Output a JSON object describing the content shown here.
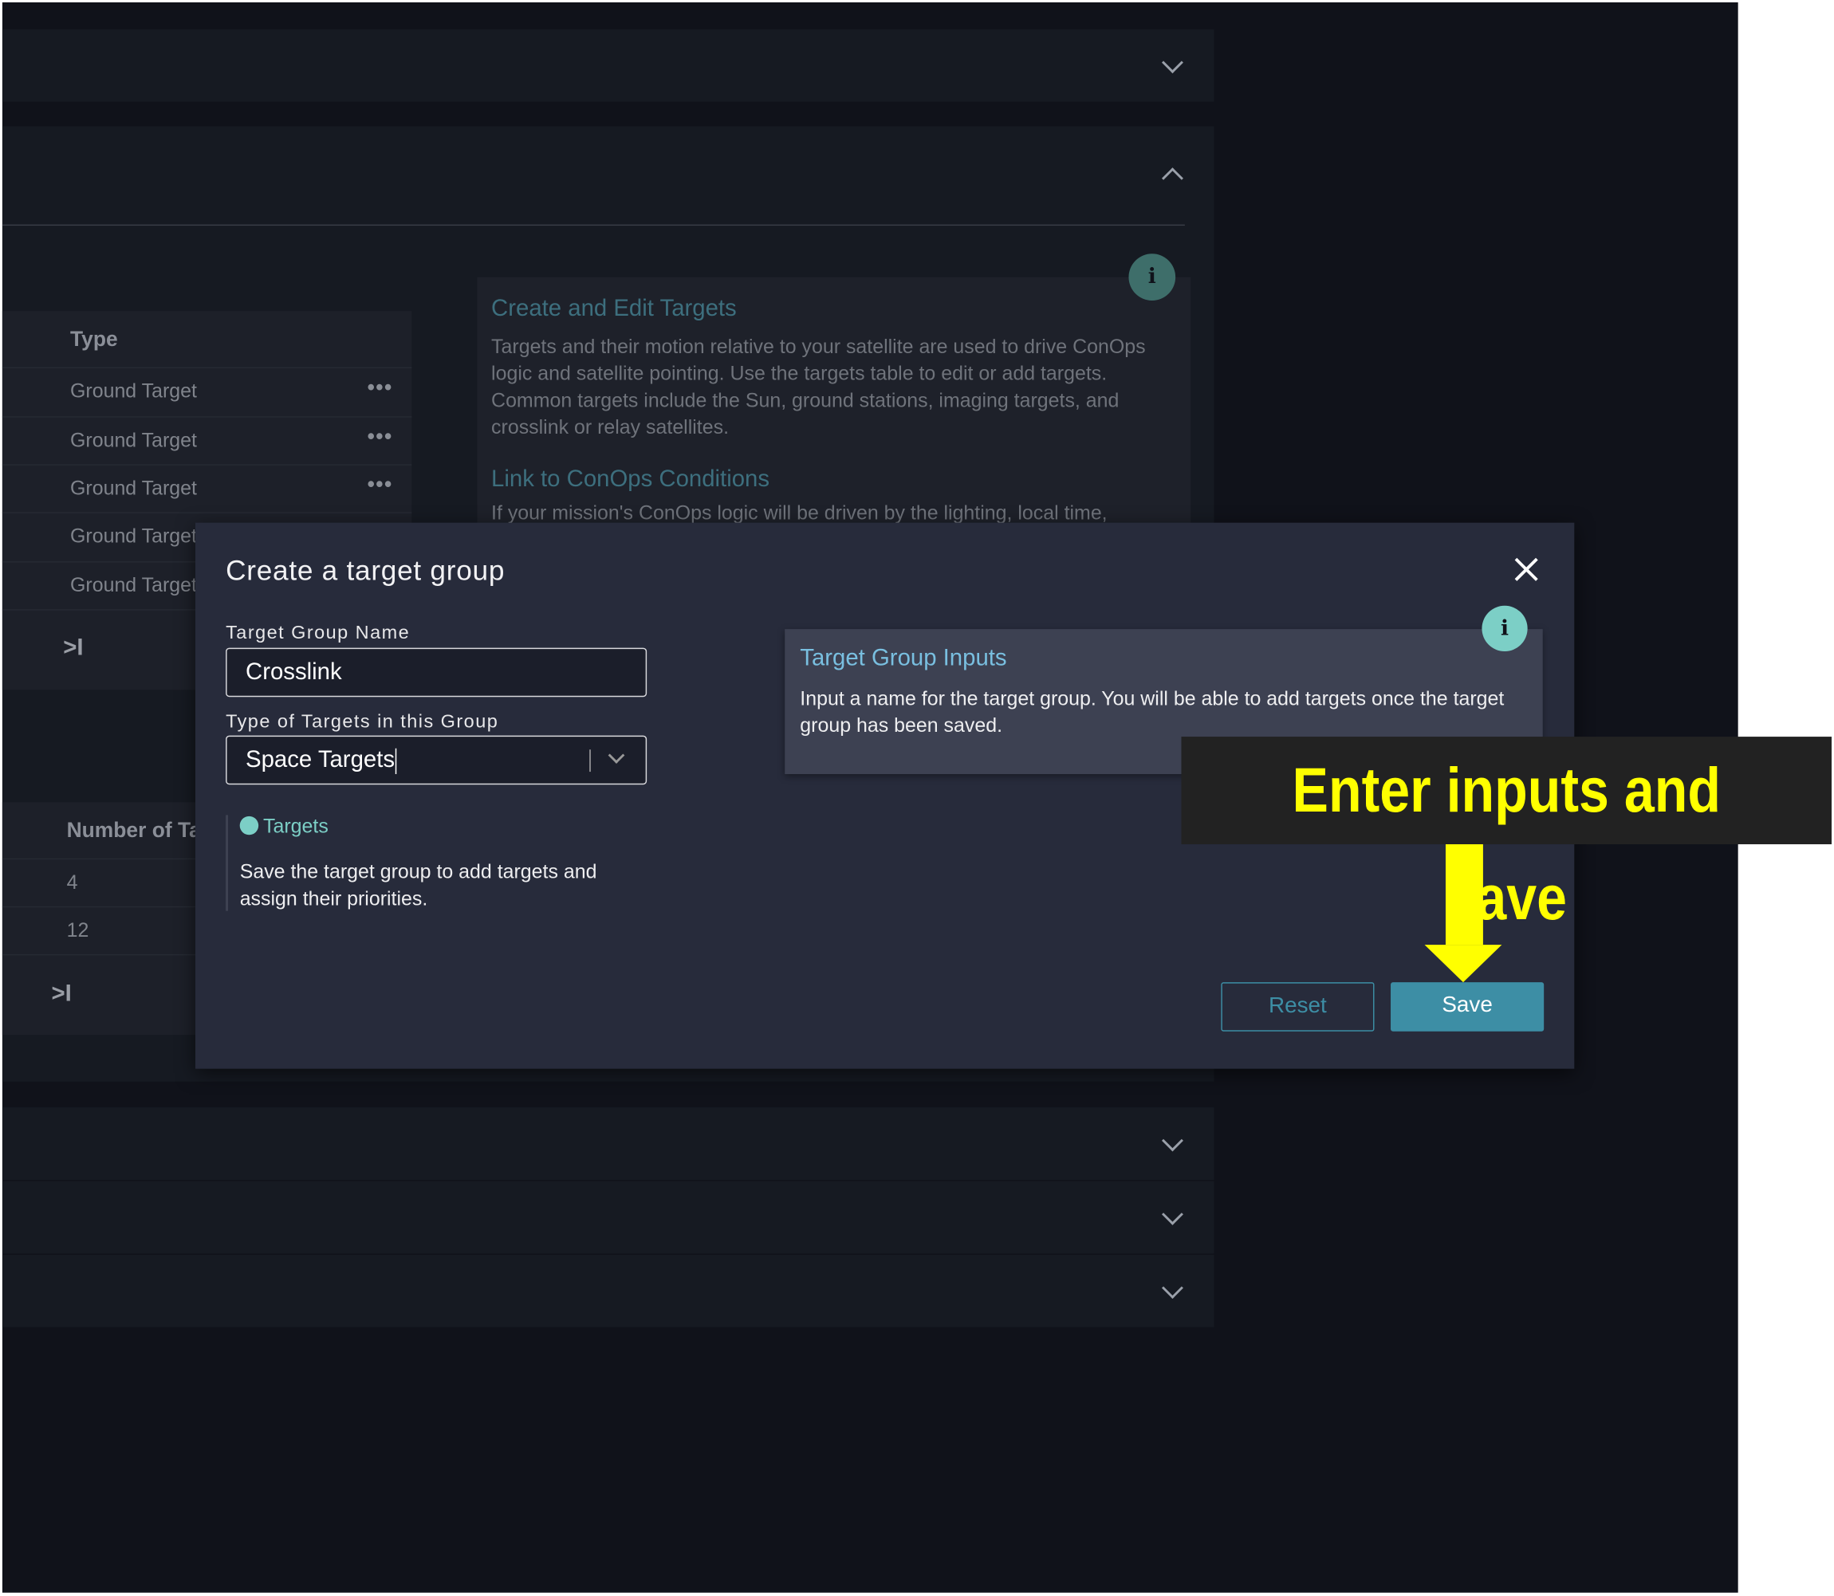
{
  "background_panels": {
    "targets_table": {
      "header": "Type",
      "rows": [
        "Ground Target",
        "Ground Target",
        "Ground Target",
        "Ground Target",
        "Ground Target"
      ],
      "pagination_last": ">I"
    },
    "groups_table": {
      "header": "Number of Ta",
      "rows": [
        "4",
        "12"
      ],
      "pagination_last": ">I"
    },
    "info": {
      "title1": "Create and Edit Targets",
      "text1": "Targets and their motion relative to your satellite are used to drive ConOps logic and satellite pointing. Use the targets table to edit or add targets. Common targets include the Sun, ground stations, imaging targets, and crosslink or relay satellites.",
      "title2": "Link to ConOps Conditions",
      "text2": "If your mission's ConOps logic will be driven by the lighting, local time,"
    }
  },
  "modal": {
    "title": "Create a target group",
    "name_label": "Target Group Name",
    "name_value": "Crosslink",
    "type_label": "Type of Targets in this Group",
    "type_value": "Space Targets",
    "targets_link": "Targets",
    "targets_note": "Save the target group to add targets and assign their priorities.",
    "info_title": "Target Group Inputs",
    "info_text": "Input a name for the target group. You will be able to add targets once the target group has been saved.",
    "reset_label": "Reset",
    "save_label": "Save"
  },
  "annotation": {
    "text": "Enter inputs and save",
    "color": "#ffff00"
  },
  "colors": {
    "accent": "#3d8ea5",
    "info_icon": "#7ccfc6",
    "modal_bg": "#272b3b"
  }
}
